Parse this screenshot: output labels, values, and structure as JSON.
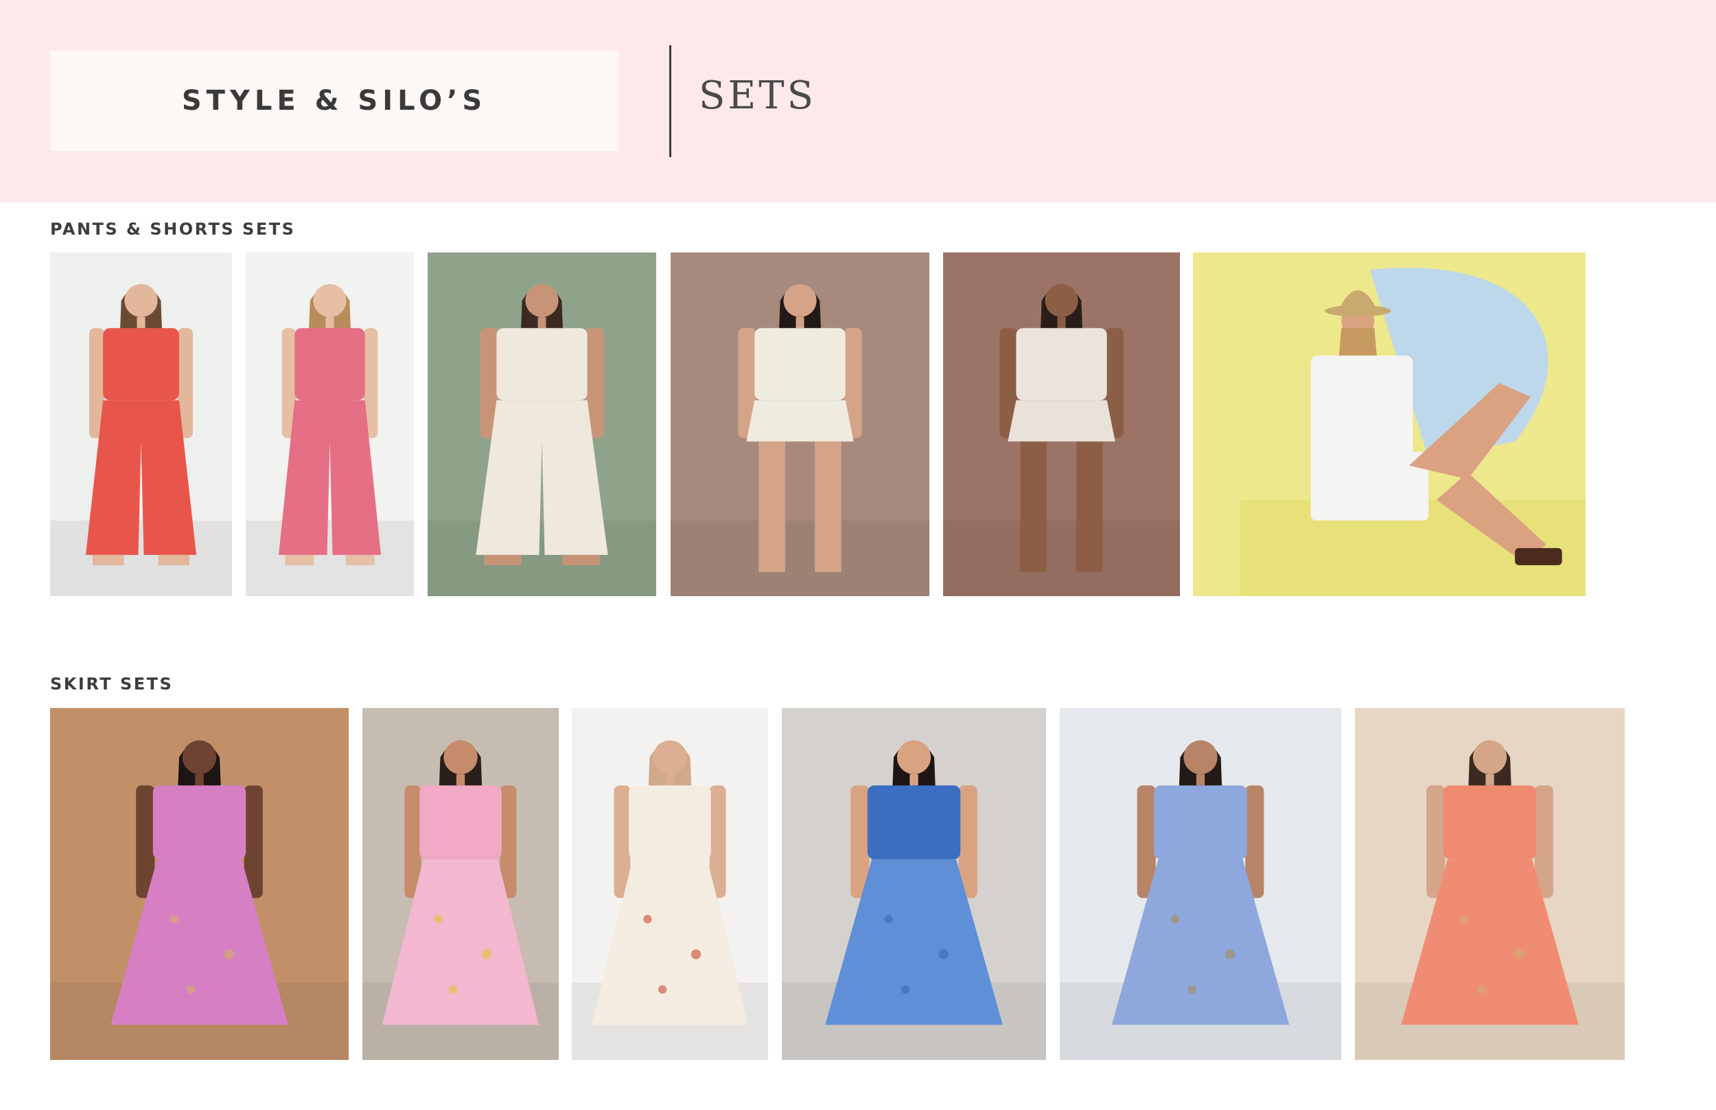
{
  "brand": {
    "logo_text": "STYLE & SILO’S"
  },
  "page": {
    "title": "SETS"
  },
  "colors": {
    "header_bg": "#fde9ea",
    "logo_bg": "#fdf7f6",
    "text": "#3a3a3a"
  },
  "sections": [
    {
      "title": "PANTS & SHORTS SETS",
      "items": [
        {
          "name": "coral-halter-wide-leg-pants-set",
          "bg": "#eef0ee",
          "top": "#e8564b",
          "bottom": "#e8564b",
          "skin": "#e2b79c",
          "hair": "#6b4a34",
          "kind": "pants",
          "accent": "#3f9a63"
        },
        {
          "name": "pink-strapless-wide-leg-set",
          "bg": "#f2f2f0",
          "top": "#e56f84",
          "bottom": "#e56f84",
          "skin": "#e6bfa4",
          "hair": "#b98c5c",
          "kind": "pants",
          "accent": "#e56f84"
        },
        {
          "name": "cream-ric-rac-trim-pants-set",
          "bg": "#8fa38a",
          "top": "#efe8dc",
          "bottom": "#efe8dc",
          "skin": "#c89478",
          "hair": "#3a2a22",
          "kind": "pants",
          "accent": "#1c1c1c"
        },
        {
          "name": "cream-ric-rac-shorts-set",
          "bg": "#a78a7d",
          "top": "#f0ebdf",
          "bottom": "#f0ebdf",
          "skin": "#d5a488",
          "hair": "#231a17",
          "kind": "shorts",
          "accent": "#1c1c1c"
        },
        {
          "name": "embroidered-white-shorts-set",
          "bg": "#9c7467",
          "top": "#eae4dc",
          "bottom": "#e8e2da",
          "skin": "#8c5e45",
          "hair": "#2a1e1a",
          "kind": "shorts",
          "accent": "#9aa6bc"
        },
        {
          "name": "striped-linen-shorts-set",
          "bg": "#eee88c",
          "top": "#f4f4f2",
          "bottom": "#f4f4f2",
          "skin": "#dba282",
          "hair": "#c79a62",
          "kind": "sitting",
          "accent": "#bcd8ea"
        }
      ]
    },
    {
      "title": "SKIRT SETS",
      "items": [
        {
          "name": "pink-eyelet-maxi-skirt-set",
          "bg": "#c19069",
          "top": "#d77fc3",
          "bottom": "#d77fc3",
          "skin": "#6e4332",
          "hair": "#1c1513",
          "kind": "skirt",
          "accent": "#d2aa70"
        },
        {
          "name": "pink-floral-halter-skirt-set",
          "bg": "#c7bcb1",
          "top": "#f2a9c6",
          "bottom": "#f3b7cf",
          "skin": "#c68c6b",
          "hair": "#2b1f1a",
          "kind": "skirt",
          "accent": "#e7c24a"
        },
        {
          "name": "seashell-print-tiered-skirt-set",
          "bg": "#f3f2f1",
          "top": "#f4ece0",
          "bottom": "#f4ece0",
          "skin": "#dcaf92",
          "hair": "#d0a988",
          "kind": "skirt",
          "accent": "#d3614c"
        },
        {
          "name": "blue-toile-tie-front-skirt-set",
          "bg": "#d5d1cf",
          "top": "#3b6dc1",
          "bottom": "#5f8fd6",
          "skin": "#d9a382",
          "hair": "#1d1614",
          "kind": "skirt",
          "accent": "#3b6dc1"
        },
        {
          "name": "blue-floral-puff-sleeve-set",
          "bg": "#e5e8ec",
          "top": "#8ea7dc",
          "bottom": "#8ea7dc",
          "skin": "#b88468",
          "hair": "#231a17",
          "kind": "skirt",
          "accent": "#a58d6b"
        },
        {
          "name": "coral-halter-maxi-skirt-set",
          "bg": "#e7d6c3",
          "top": "#ef8a70",
          "bottom": "#f08c73",
          "skin": "#d4a588",
          "hair": "#3c2a22",
          "kind": "skirt",
          "accent": "#d2aa70"
        }
      ]
    }
  ]
}
